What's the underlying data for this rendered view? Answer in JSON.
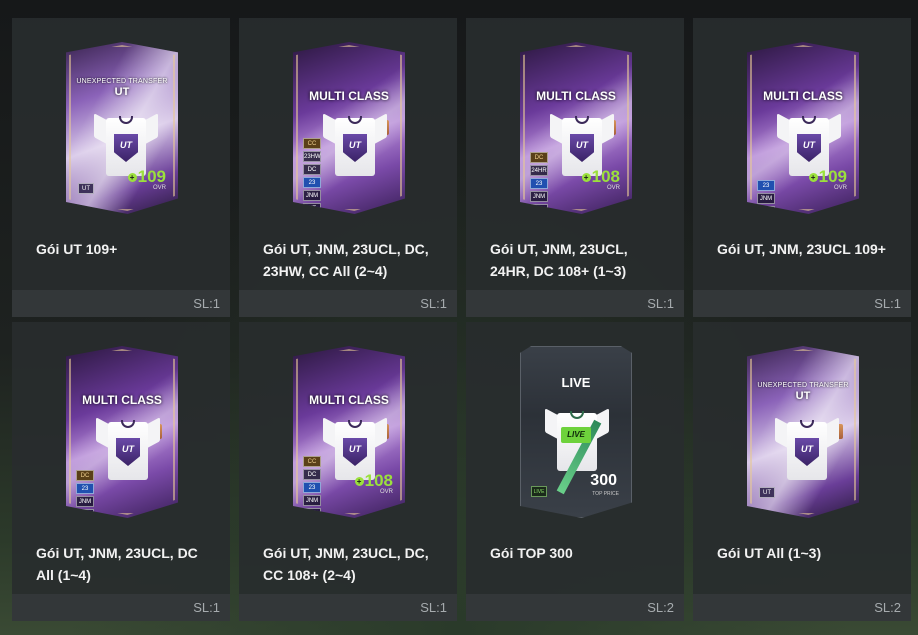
{
  "packs": [
    {
      "card_subtitle": "UNEXPECTED TRANSFER",
      "card_title": "UT",
      "ovr": "109",
      "ovr_label": "OVR",
      "tags": [],
      "bottom_tag": "UT",
      "rank": "",
      "name": "Gói UT 109+",
      "qty": "SL:1"
    },
    {
      "card_subtitle": "",
      "card_title": "MULTI CLASS",
      "ovr": "",
      "ovr_label": "",
      "tags": [
        "CC",
        "23HW",
        "DC",
        "23",
        "JNM",
        "UT"
      ],
      "bottom_tag": "",
      "rank": "4",
      "name": "Gói UT, JNM, 23UCL, DC, 23HW, CC All (2~4)",
      "qty": "SL:1"
    },
    {
      "card_subtitle": "",
      "card_title": "MULTI CLASS",
      "ovr": "108",
      "ovr_label": "OVR",
      "tags": [
        "DC",
        "24HR",
        "23",
        "JNM",
        "UT"
      ],
      "bottom_tag": "",
      "rank": "3",
      "name": "Gói UT, JNM, 23UCL, 24HR, DC 108+ (1~3)",
      "qty": "SL:1"
    },
    {
      "card_subtitle": "",
      "card_title": "MULTI CLASS",
      "ovr": "109",
      "ovr_label": "OVR",
      "tags": [
        "23",
        "JNM",
        "UT"
      ],
      "bottom_tag": "",
      "rank": "",
      "name": "Gói UT, JNM, 23UCL 109+",
      "qty": "SL:1"
    },
    {
      "card_subtitle": "",
      "card_title": "MULTI CLASS",
      "ovr": "",
      "ovr_label": "",
      "tags": [
        "DC",
        "23",
        "JNM",
        "UT"
      ],
      "bottom_tag": "",
      "rank": "4",
      "name": "Gói UT, JNM, 23UCL, DC All (1~4)",
      "qty": "SL:1"
    },
    {
      "card_subtitle": "",
      "card_title": "MULTI CLASS",
      "ovr": "108",
      "ovr_label": "OVR",
      "tags": [
        "CC",
        "DC",
        "23",
        "JNM",
        "UT"
      ],
      "bottom_tag": "",
      "rank": "4",
      "name": "Gói UT, JNM, 23UCL, DC, CC 108+ (2~4)",
      "qty": "SL:1"
    },
    {
      "card_title": "LIVE",
      "shirt_badge": "LIVE",
      "top_value": "300",
      "top_label": "TOP PRICE",
      "bottom_tag": "LIVE",
      "name": "Gói TOP 300",
      "qty": "SL:2"
    },
    {
      "card_subtitle": "UNEXPECTED TRANSFER",
      "card_title": "UT",
      "ovr": "",
      "ovr_label": "",
      "tags": [],
      "bottom_tag": "UT",
      "rank": "3",
      "name": "Gói UT All (1~3)",
      "qty": "SL:2"
    }
  ]
}
